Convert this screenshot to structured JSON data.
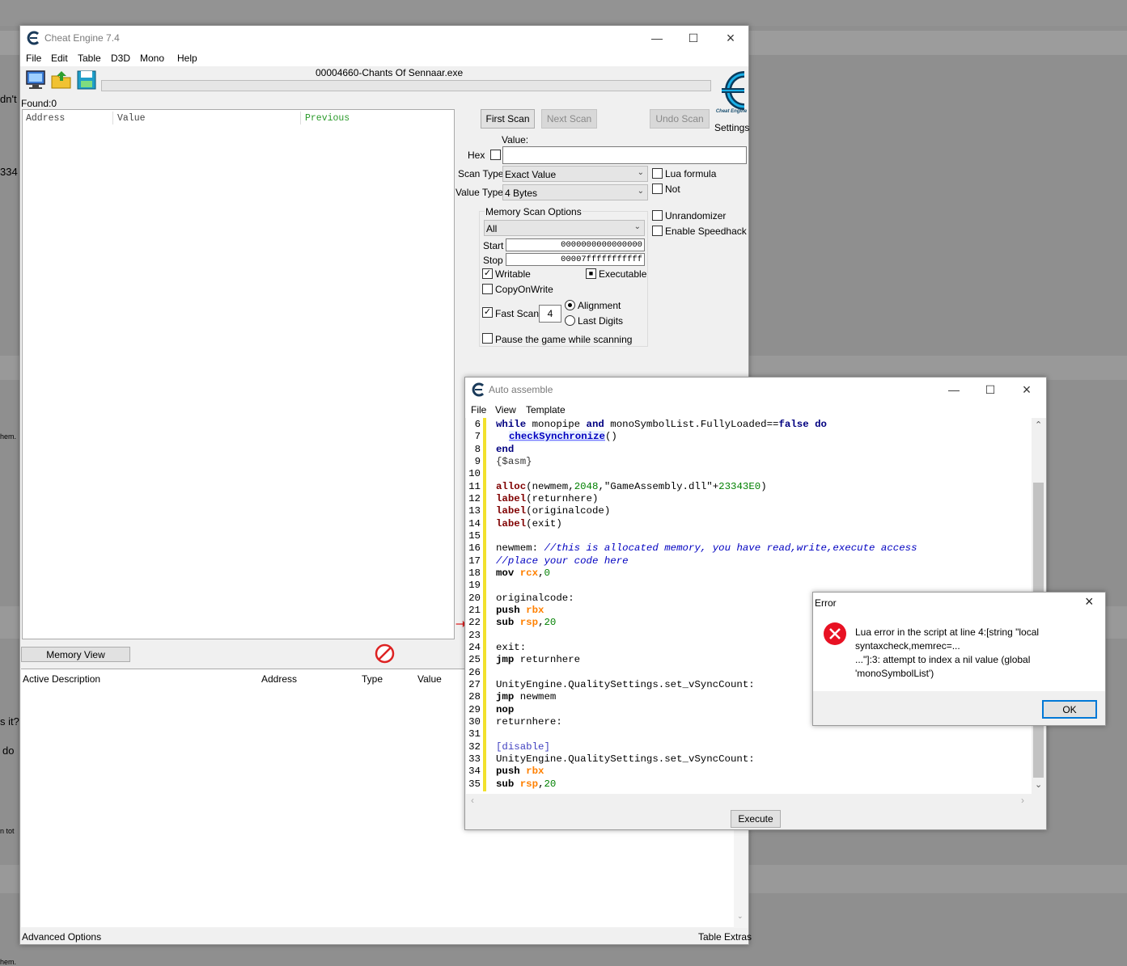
{
  "background": {
    "snippets": [
      "dn't",
      "334",
      "hem.",
      "s it?",
      "do",
      "n tot",
      "hem."
    ]
  },
  "main_window": {
    "title": "Cheat Engine 7.4",
    "menu": [
      "File",
      "Edit",
      "Table",
      "D3D",
      "Mono",
      "Help"
    ],
    "process_name": "00004660-Chants Of Sennaar.exe",
    "found_label": "Found:0",
    "settings_label": "Settings",
    "logo_caption": "Cheat Engine",
    "columns": {
      "address": "Address",
      "value": "Value",
      "previous": "Previous"
    },
    "buttons": {
      "first_scan": "First Scan",
      "next_scan": "Next Scan",
      "undo_scan": "Undo Scan"
    },
    "value_label": "Value:",
    "hex_label": "Hex",
    "scan_type_label": "Scan Type",
    "scan_type_value": "Exact Value",
    "value_type_label": "Value Type",
    "value_type_value": "4 Bytes",
    "lua_formula": "Lua formula",
    "not_label": "Not",
    "memory_scan_options": "Memory Scan Options",
    "memory_region": "All",
    "start_label": "Start",
    "start_value": "0000000000000000",
    "stop_label": "Stop",
    "stop_value": "00007fffffffffff",
    "writable": "Writable",
    "executable": "Executable",
    "copy_on_write": "CopyOnWrite",
    "fast_scan": "Fast Scan",
    "fast_scan_value": "4",
    "alignment": "Alignment",
    "last_digits": "Last Digits",
    "pause_game": "Pause the game while scanning",
    "unrandomizer": "Unrandomizer",
    "enable_speedhack": "Enable Speedhack",
    "memory_view": "Memory View",
    "table_columns": {
      "active_description": "Active Description",
      "address": "Address",
      "type": "Type",
      "value": "Value"
    },
    "advanced_options": "Advanced Options",
    "table_extras": "Table Extras"
  },
  "auto_assemble": {
    "title": "Auto assemble",
    "menu": [
      "File",
      "View",
      "Template"
    ],
    "execute": "Execute",
    "line_numbers": [
      "6",
      "7",
      "8",
      "9",
      "10",
      "11",
      "12",
      "13",
      "14",
      "15",
      "16",
      "17",
      "18",
      "19",
      "20",
      "21",
      "22",
      "23",
      "24",
      "25",
      "26",
      "27",
      "28",
      "29",
      "30",
      "31",
      "32",
      "33",
      "34",
      "35"
    ],
    "code": {
      "l6_a": "while",
      "l6_b": " monopipe ",
      "l6_c": "and",
      "l6_d": " monoSymbolList.FullyLoaded==",
      "l6_e": "false",
      "l6_f": " do",
      "l7_a": "checkSynchronize",
      "l7_b": "()",
      "l8": "end",
      "l9": "{$asm}",
      "l11_a": "alloc",
      "l11_b": "(newmem,",
      "l11_c": "2048",
      "l11_d": ",\"GameAssembly.dll\"+",
      "l11_e": "23343E0",
      "l11_f": ")",
      "l12_a": "label",
      "l12_b": "(returnhere)",
      "l13_a": "label",
      "l13_b": "(originalcode)",
      "l14_a": "label",
      "l14_b": "(exit)",
      "l16_a": "newmem: ",
      "l16_b": "//this is allocated memory, you have read,write,execute access",
      "l17": "//place your code here",
      "l18_a": "mov",
      "l18_b": " rcx",
      "l18_c": ",",
      "l18_d": "0",
      "l20": "originalcode:",
      "l21_a": "push",
      "l21_b": " rbx",
      "l22_a": "sub",
      "l22_b": " rsp",
      "l22_c": ",",
      "l22_d": "20",
      "l24": "exit:",
      "l25_a": "jmp",
      "l25_b": " returnhere",
      "l27": "UnityEngine.QualitySettings.set_vSyncCount:",
      "l28_a": "jmp",
      "l28_b": " newmem",
      "l29": "nop",
      "l30": "returnhere:",
      "l32": "[disable]",
      "l33": "UnityEngine.QualitySettings.set_vSyncCount:",
      "l34_a": "push",
      "l34_b": " rbx",
      "l35_a": "sub",
      "l35_b": " rsp",
      "l35_c": ",",
      "l35_d": "20"
    }
  },
  "error_dialog": {
    "title": "Error",
    "line1": "Lua error in the script at line 4:[string \"local",
    "line2": "syntaxcheck,memrec=...",
    "line3": "...\"]:3: attempt to index a nil value (global",
    "line4": "'monoSymbolList')",
    "ok": "OK"
  },
  "colors": {
    "accent_blue": "#0078d7",
    "error_red": "#e81123",
    "code_keyword": "#000080",
    "code_label": "#800000",
    "code_register": "#ff8000",
    "code_number": "#008000",
    "code_comment": "#0000c0"
  }
}
